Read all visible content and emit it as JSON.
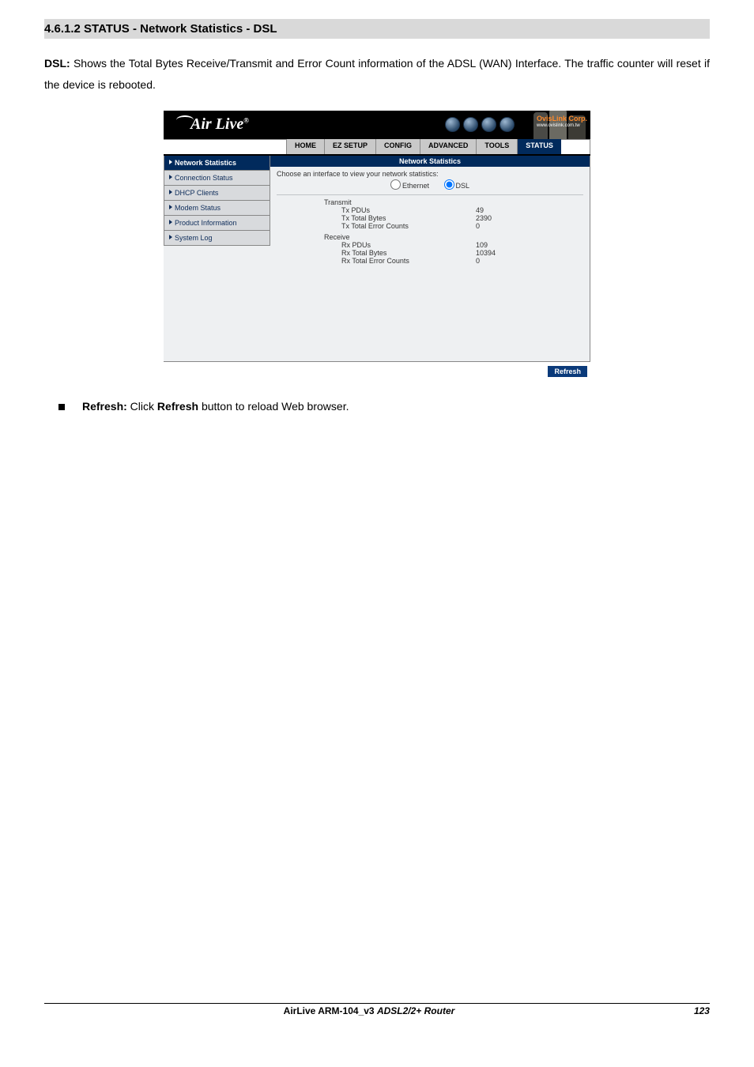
{
  "heading": "4.6.1.2 STATUS - Network Statistics - DSL",
  "paragraph": {
    "lead": "DSL:",
    "text": " Shows the Total Bytes Receive/Transmit and Error Count information of the ADSL (WAN) Interface. The traffic counter will reset if the device is rebooted."
  },
  "router": {
    "logo": "Air Live",
    "ovislink": "OvisLink Corp.",
    "ovislink_url": "www.ovislink.com.tw",
    "tabs": [
      "HOME",
      "EZ SETUP",
      "CONFIG",
      "ADVANCED",
      "TOOLS",
      "STATUS"
    ],
    "activeTab": 5,
    "side": [
      "Network Statistics",
      "Connection Status",
      "DHCP Clients",
      "Modem Status",
      "Product Information",
      "System Log"
    ],
    "activeSide": 0,
    "panelTitle": "Network Statistics",
    "choose": "Choose an interface to view your network statistics:",
    "radios": [
      {
        "label": "Ethernet",
        "checked": false
      },
      {
        "label": "DSL",
        "checked": true
      }
    ],
    "transmitLabel": "Transmit",
    "receiveLabel": "Receive",
    "tx": [
      {
        "k": "Tx PDUs",
        "v": "49"
      },
      {
        "k": "Tx Total Bytes",
        "v": "2390"
      },
      {
        "k": "Tx Total Error Counts",
        "v": "0"
      }
    ],
    "rx": [
      {
        "k": "Rx PDUs",
        "v": "109"
      },
      {
        "k": "Rx Total Bytes",
        "v": "10394"
      },
      {
        "k": "Rx Total Error Counts",
        "v": "0"
      }
    ],
    "refresh": "Refresh"
  },
  "bullet": {
    "b1": "Refresh:",
    "t1": " Click ",
    "b2": "Refresh",
    "t2": " button to reload Web browser."
  },
  "footer": {
    "left1": "AirLive ARM-104_v3 ",
    "left2": "ADSL2/2+ Router",
    "page": "123"
  }
}
